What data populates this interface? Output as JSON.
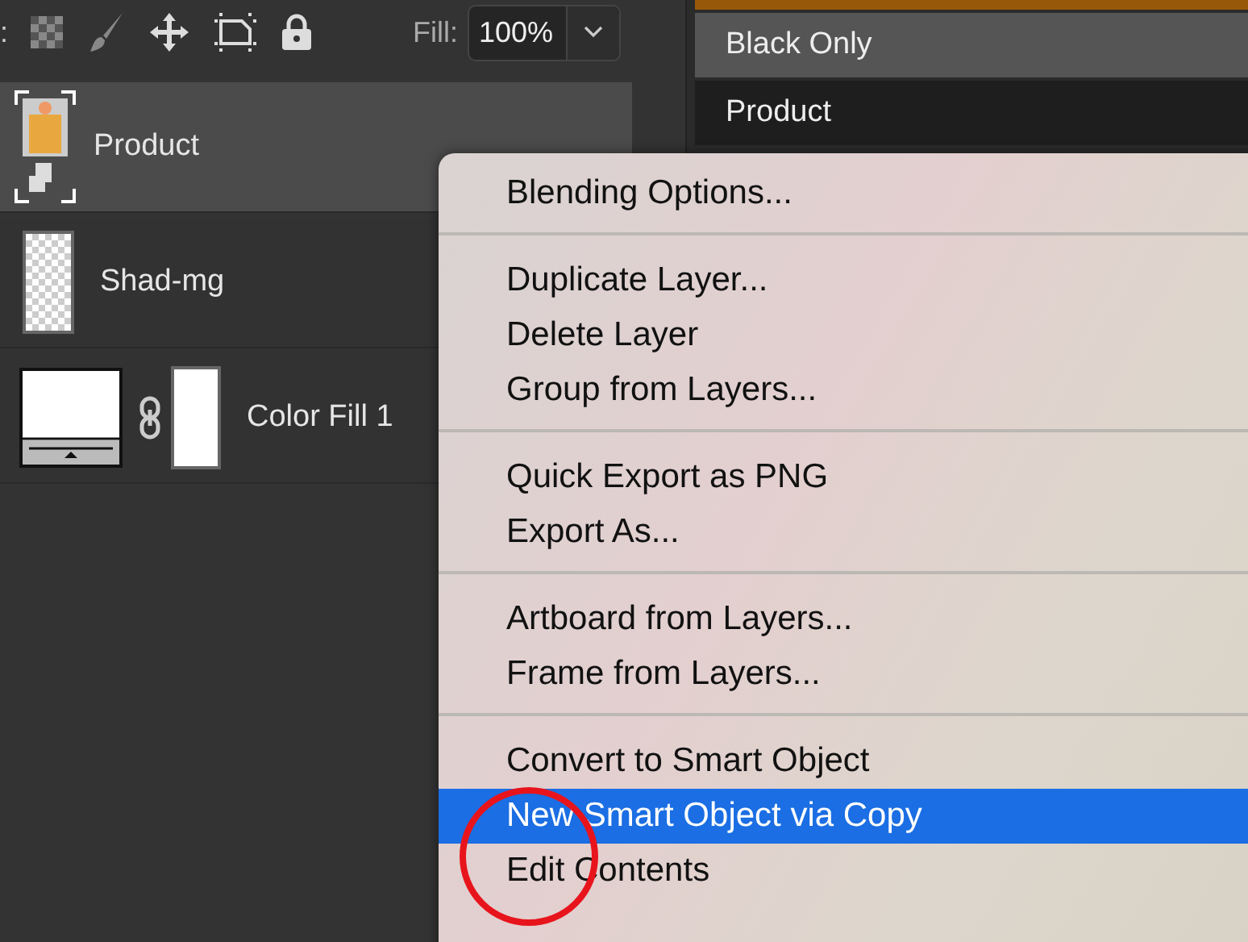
{
  "toolbar": {
    "lock_label": ":",
    "fill_label": "Fill:",
    "fill_value": "100%"
  },
  "layers": [
    {
      "name": "Product",
      "kind": "smart",
      "selected": true
    },
    {
      "name": "Shad-mg",
      "kind": "transparent",
      "selected": false
    },
    {
      "name": "Color Fill 1",
      "kind": "fill",
      "selected": false
    }
  ],
  "side_list": [
    {
      "label": "Black Only",
      "selected": true
    },
    {
      "label": "Product",
      "selected": false
    }
  ],
  "context_menu": [
    {
      "kind": "item",
      "label": "Blending Options...",
      "selected": false
    },
    {
      "kind": "separator"
    },
    {
      "kind": "item",
      "label": "Duplicate Layer...",
      "selected": false
    },
    {
      "kind": "item",
      "label": "Delete Layer",
      "selected": false
    },
    {
      "kind": "item",
      "label": "Group from Layers...",
      "selected": false
    },
    {
      "kind": "separator"
    },
    {
      "kind": "item",
      "label": "Quick Export as PNG",
      "selected": false
    },
    {
      "kind": "item",
      "label": "Export As...",
      "selected": false
    },
    {
      "kind": "separator"
    },
    {
      "kind": "item",
      "label": "Artboard from Layers...",
      "selected": false
    },
    {
      "kind": "item",
      "label": "Frame from Layers...",
      "selected": false
    },
    {
      "kind": "separator"
    },
    {
      "kind": "item",
      "label": "Convert to Smart Object",
      "selected": false
    },
    {
      "kind": "item",
      "label": "New Smart Object via Copy",
      "selected": true
    },
    {
      "kind": "item",
      "label": "Edit Contents",
      "selected": false
    }
  ]
}
